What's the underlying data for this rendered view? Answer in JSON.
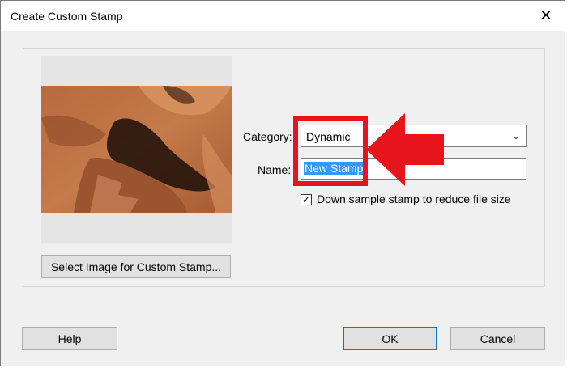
{
  "window": {
    "title": "Create Custom Stamp",
    "close_glyph": "✕"
  },
  "preview": {
    "select_button": "Select Image for Custom Stamp..."
  },
  "form": {
    "category_label": "Category:",
    "category_value": "Dynamic",
    "name_label": "Name:",
    "name_value": "New Stamp",
    "downsample_label": "Down sample stamp to reduce file size",
    "downsample_checked": true
  },
  "buttons": {
    "help": "Help",
    "ok": "OK",
    "cancel": "Cancel"
  },
  "colors": {
    "highlight": "#e8141c",
    "selection": "#3399ff",
    "ok_border": "#0078d7"
  },
  "icons": {
    "close": "close-icon",
    "dropdown": "chevron-down-icon",
    "check": "checkmark-icon",
    "annotation": "red-arrow-icon"
  }
}
